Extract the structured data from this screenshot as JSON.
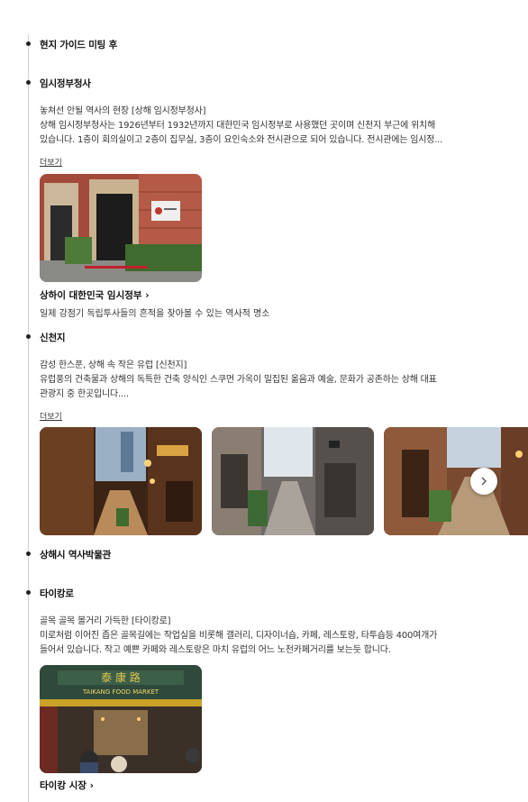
{
  "itinerary": {
    "stop0": {
      "title": "현지 가이드 미팅 후"
    },
    "stop1": {
      "title": "임시정부청사",
      "desc_lines": [
        "놓쳐선 안될 역사의 현장 [상해 임시정부청사]",
        "상해 임시정부청사는 1926년부터 1932년까지 대한민국 임시정부로 사용했던 곳이며 신천지 부근에 위치해",
        "있습니다. 1층이 회의실이고 2층이 집무실, 3층이 요인숙소와 전시관으로 되어 있습니다. 전시관에는 임시정..."
      ],
      "more": "더보기",
      "poi_name": "상하이 대한민국 임시정부 ›",
      "poi_sub": "일제 강점기 독립투사들의 흔적을 찾아볼 수 있는 역사적 명소"
    },
    "stop2": {
      "title": "신천지",
      "desc_lines": [
        "감성 한스푼, 상해 속 작은 유럽 [신천지]",
        "유럽풍의 건축물과 상해의 독특한 건축 양식인 스쿠먼 가옥이 밀집된 옮음과 예술, 문화가 공존하는 상해 대표",
        "관광지 중 한곳입니다...."
      ],
      "more": "더보기",
      "next_icon": "chevron-right-icon"
    },
    "stop3": {
      "title": "상해시 역사박물관"
    },
    "stop4": {
      "title": "타이캉로",
      "desc_lines": [
        "골목 골목 볼거리 가득한 [타이캉로]",
        "미로처럼 이어진 좁은 골목길에는 작업실을 비롯해 갤러리, 디자이너숍, 카페, 레스토랑, 타투숍등 400여개가",
        "들어서 있습니다. 작고 예쁜 카페와 레스토랑은 마치 유럽의 어느 노천카페거리를 보는듯 합니다."
      ],
      "poi_name": "타이캉 시장 ›",
      "sign_text": "TAIKANG FOOD MARKET"
    }
  },
  "colors": {
    "brick": "#a34a3a",
    "timeline": "#cfcfcf",
    "text": "#222222"
  }
}
